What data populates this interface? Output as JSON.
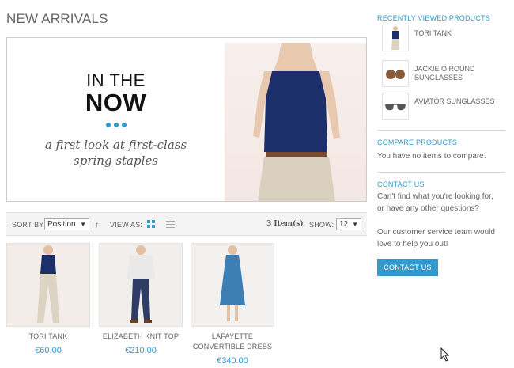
{
  "page": {
    "title": "NEW ARRIVALS"
  },
  "banner": {
    "line1": "IN THE",
    "line2": "NOW",
    "tagline_1": "a first look at first-class",
    "tagline_2": "spring staples"
  },
  "toolbar": {
    "sort_label": "SORT BY:",
    "sort_value": "Position",
    "view_label": "VIEW AS:",
    "item_count": "3 Item(s)",
    "show_label": "SHOW:",
    "show_value": "12"
  },
  "products": [
    {
      "name": "TORI TANK",
      "price": "€60.00"
    },
    {
      "name": "ELIZABETH KNIT TOP",
      "price": "€210.00"
    },
    {
      "name_1": "LAFAYETTE",
      "name_2": "CONVERTIBLE DRESS",
      "price": "€340.00"
    }
  ],
  "sidebar": {
    "recently_viewed": {
      "title": "RECENTLY VIEWED PRODUCTS",
      "items": [
        {
          "name": "TORI TANK",
          "icon": "tank-top-thumbnail"
        },
        {
          "name_1": "JACKIE O ROUND",
          "name_2": "SUNGLASSES",
          "icon": "round-sunglasses-thumbnail"
        },
        {
          "name": "AVIATOR SUNGLASSES",
          "icon": "aviator-sunglasses-thumbnail"
        }
      ]
    },
    "compare": {
      "title": "COMPARE PRODUCTS",
      "text": "You have no items to compare."
    },
    "contact": {
      "title": "CONTACT US",
      "text_1": "Can't find what you're looking for,",
      "text_2": "or have any other questions?",
      "text_3": "Our customer service team would",
      "text_4": "love to help you out!",
      "button": "CONTACT US"
    }
  },
  "colors": {
    "accent": "#3399cc",
    "text": "#636363",
    "border": "#e2e2e2"
  }
}
